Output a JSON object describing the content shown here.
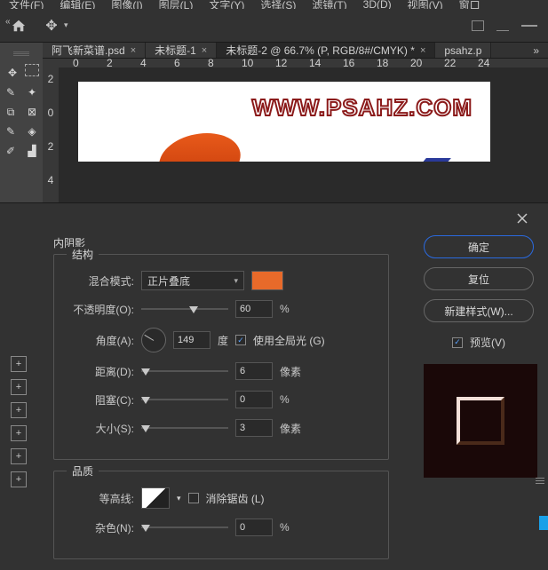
{
  "menu": [
    "文件(F)",
    "编辑(E)",
    "图像(I)",
    "图层(L)",
    "文字(Y)",
    "选择(S)",
    "滤镜(T)",
    "3D(D)",
    "视图(V)",
    "窗口"
  ],
  "tabs": [
    {
      "label": "阿飞新菜谱.psd"
    },
    {
      "label": "未标题-1"
    },
    {
      "label": "未标题-2 @ 66.7% (P, RGB/8#/CMYK) *"
    },
    {
      "label": "psahz.p"
    }
  ],
  "rulerH": [
    "0",
    "2",
    "4",
    "6",
    "8",
    "10",
    "12",
    "14",
    "16",
    "18",
    "20",
    "22",
    "24"
  ],
  "rulerV": [
    "2",
    "0",
    "2",
    "4"
  ],
  "watermark": "WWW.PSAHZ.COM",
  "dialog": {
    "title": "内阴影",
    "structure": "结构",
    "blendLabel": "混合模式:",
    "blendValue": "正片叠底",
    "opacityLabel": "不透明度(O):",
    "opacityValue": "60",
    "pct": "%",
    "angleLabel": "角度(A):",
    "angleValue": "149",
    "deg": "度",
    "globalLight": "使用全局光 (G)",
    "distanceLabel": "距离(D):",
    "distanceValue": "6",
    "px": "像素",
    "spreadLabel": "阻塞(C):",
    "spreadValue": "0",
    "sizeLabel": "大小(S):",
    "sizeValue": "3",
    "quality": "品质",
    "contourLabel": "等高线:",
    "antiAlias": "消除锯齿 (L)",
    "noiseLabel": "杂色(N):",
    "noiseValue": "0",
    "swatchColor": "#e86a2a"
  },
  "buttons": {
    "ok": "确定",
    "reset": "复位",
    "newStyle": "新建样式(W)...",
    "preview": "预览(V)"
  }
}
